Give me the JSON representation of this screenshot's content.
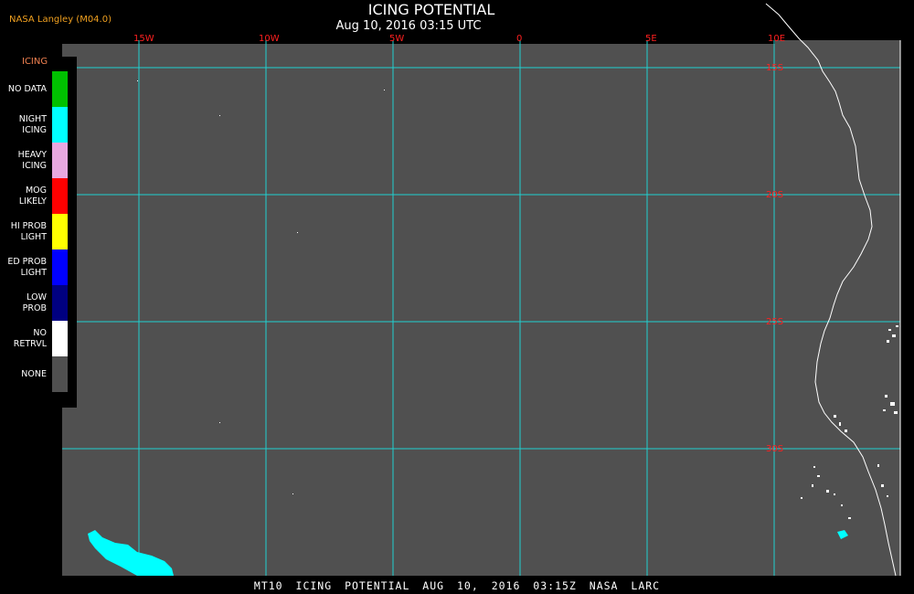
{
  "header": {
    "agency": "NASA Langley (M04.0)",
    "title": "ICING POTENTIAL",
    "subtitle": "Aug 10, 2016 03:15 UTC"
  },
  "map": {
    "background_color": "#505050",
    "grid_color": "#20d0d0",
    "coast_color": "#ffffff",
    "icing_color": "#00ffff",
    "lon_labels": [
      "15W",
      "10W",
      "5W",
      "0",
      "5E",
      "10E"
    ],
    "lat_labels": [
      "15S",
      "20S",
      "25S",
      "30S"
    ]
  },
  "legend": {
    "title": "ICING",
    "items": [
      {
        "label": "NO DATA",
        "color": "#00c000"
      },
      {
        "label": "NIGHT\nICING",
        "color": "#00ffff"
      },
      {
        "label": "HEAVY\nICING",
        "color": "#e8a8e0"
      },
      {
        "label": "MOG\nLIKELY",
        "color": "#ff0000"
      },
      {
        "label": "HI PROB\nLIGHT",
        "color": "#ffff00"
      },
      {
        "label": "ED PROB\nLIGHT",
        "color": "#0000ff"
      },
      {
        "label": "LOW\nPROB",
        "color": "#000080"
      },
      {
        "label": "NO\nRETRVL",
        "color": "#ffffff"
      },
      {
        "label": "NONE",
        "color": "#505050"
      }
    ]
  },
  "footer": {
    "text": "MT10 ICING POTENTIAL AUG 10, 2016 03:15Z NASA LARC"
  }
}
